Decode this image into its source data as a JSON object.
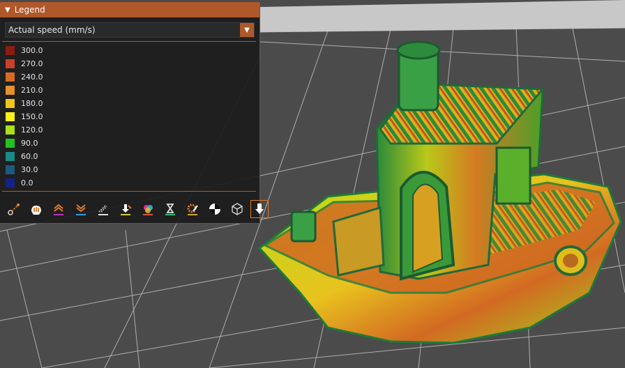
{
  "legend": {
    "title": "Legend",
    "view_type": "Actual speed (mm/s)",
    "scale": [
      {
        "label": "300.0",
        "color": "#8c1c10"
      },
      {
        "label": "270.0",
        "color": "#c8402a"
      },
      {
        "label": "240.0",
        "color": "#d86a24"
      },
      {
        "label": "210.0",
        "color": "#e5922a"
      },
      {
        "label": "180.0",
        "color": "#f0c41a"
      },
      {
        "label": "150.0",
        "color": "#f7f01a"
      },
      {
        "label": "120.0",
        "color": "#a9e01a"
      },
      {
        "label": "90.0",
        "color": "#1fc41f"
      },
      {
        "label": "60.0",
        "color": "#1a8a8a"
      },
      {
        "label": "30.0",
        "color": "#1a5a80"
      },
      {
        "label": "0.0",
        "color": "#13238a"
      }
    ]
  },
  "toolbar": {
    "icons": [
      "travel-icon",
      "wipe-icon",
      "retractions-icon",
      "deretractions-icon",
      "seams-icon",
      "tool-changes-icon",
      "color-changes-icon",
      "pause-prints-icon",
      "custom-gcodes-icon",
      "center-of-gravity-icon",
      "shells-icon",
      "tool-marker-icon"
    ]
  }
}
